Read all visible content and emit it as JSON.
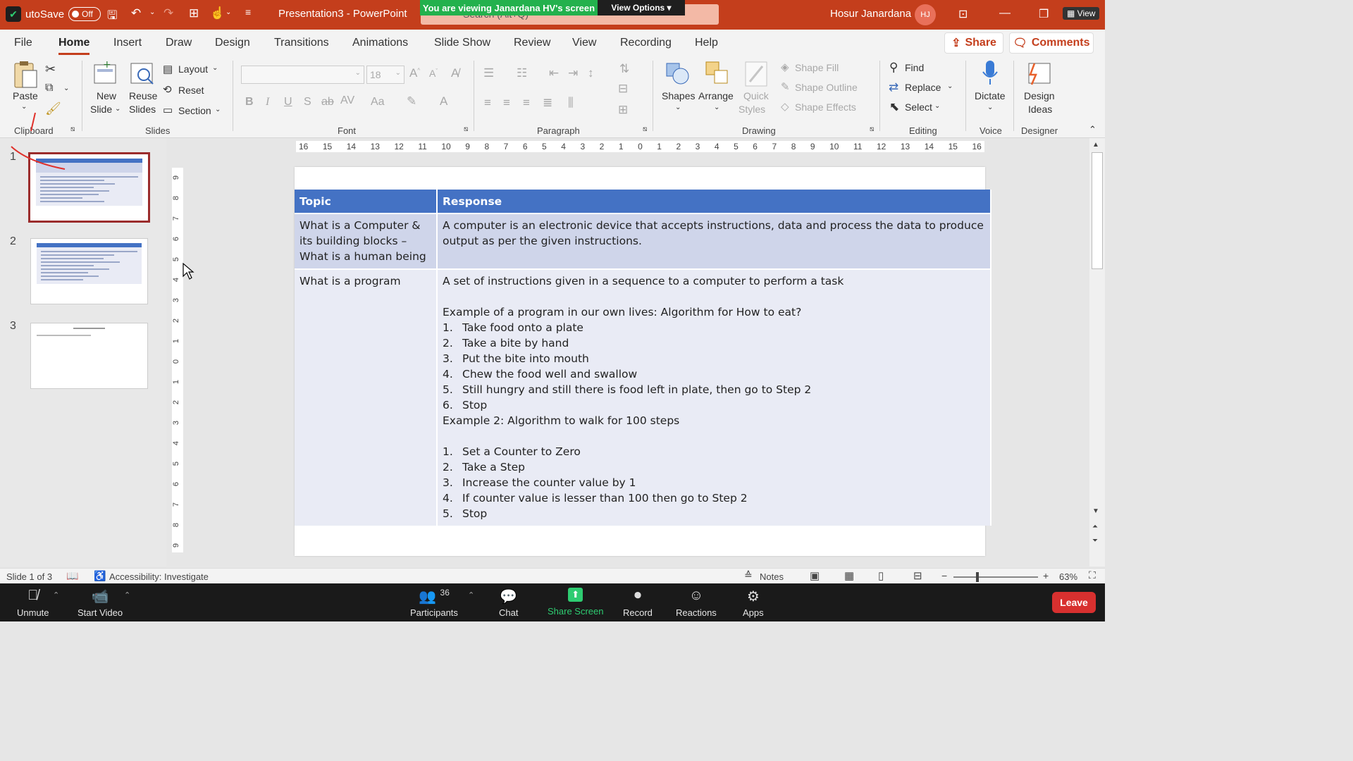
{
  "titlebar": {
    "autosave_label": "utoSave",
    "autosave_state": "Off",
    "title": "Presentation3  -  PowerPoint",
    "search_placeholder": "Search (Alt+Q)",
    "viewing_banner": "You are viewing Janardana HV's screen",
    "view_options": "View Options ▾",
    "user_name": "Hosur Janardana",
    "user_initials": "HJ",
    "view_btn": "View"
  },
  "menu": {
    "tabs": [
      "File",
      "Home",
      "Insert",
      "Draw",
      "Design",
      "Transitions",
      "Animations",
      "Slide Show",
      "Review",
      "View",
      "Recording",
      "Help"
    ],
    "share": "Share",
    "comments": "Comments"
  },
  "ribbon": {
    "clipboard": {
      "paste": "Paste",
      "label": "Clipboard"
    },
    "slides": {
      "new_slide_1": "New",
      "new_slide_2": "Slide",
      "reuse_1": "Reuse",
      "reuse_2": "Slides",
      "layout": "Layout",
      "reset": "Reset",
      "section": "Section",
      "label": "Slides"
    },
    "font": {
      "size": "18",
      "label": "Font"
    },
    "paragraph": {
      "label": "Paragraph"
    },
    "drawing": {
      "shapes": "Shapes",
      "arrange": "Arrange",
      "quick_styles_1": "Quick",
      "quick_styles_2": "Styles",
      "shape_fill": "Shape Fill",
      "shape_outline": "Shape Outline",
      "shape_effects": "Shape Effects",
      "label": "Drawing"
    },
    "editing": {
      "find": "Find",
      "replace": "Replace",
      "select": "Select",
      "label": "Editing"
    },
    "voice": {
      "dictate": "Dictate",
      "label": "Voice"
    },
    "designer": {
      "ideas_1": "Design",
      "ideas_2": "Ideas",
      "label": "Designer"
    }
  },
  "slides_pane": {
    "numbers": [
      "1",
      "2",
      "3"
    ]
  },
  "ruler": {
    "ticks": [
      "16",
      "15",
      "14",
      "13",
      "12",
      "11",
      "10",
      "9",
      "8",
      "7",
      "6",
      "5",
      "4",
      "3",
      "2",
      "1",
      "0",
      "1",
      "2",
      "3",
      "4",
      "5",
      "6",
      "7",
      "8",
      "9",
      "10",
      "11",
      "12",
      "13",
      "14",
      "15",
      "16"
    ],
    "vticks": [
      "9",
      "8",
      "7",
      "6",
      "5",
      "4",
      "3",
      "2",
      "1",
      "0",
      "1",
      "2",
      "3",
      "4",
      "5",
      "6",
      "7",
      "8",
      "9"
    ]
  },
  "table": {
    "headers": [
      "Topic",
      "Response"
    ],
    "row1": {
      "topic": "What is a Computer & its building blocks – What is a human being",
      "response": "A computer is an electronic device that accepts instructions, data and process the data to produce output as per the given instructions."
    },
    "row2": {
      "topic": "What is  a program",
      "intro": "A set of instructions given in a sequence to a computer to perform a task",
      "example1_title": "Example of a program in our own lives: Algorithm for How to eat?",
      "example1_steps": [
        {
          "n": "1.",
          "t": "Take food onto a plate"
        },
        {
          "n": "2.",
          "t": "Take a bite by hand"
        },
        {
          "n": "3.",
          "t": "Put the bite into mouth"
        },
        {
          "n": "4.",
          "t": "Chew the food well and swallow"
        },
        {
          "n": "5.",
          "t": "Still hungry and still there is food left in plate, then go to Step 2"
        },
        {
          "n": "6.",
          "t": "Stop"
        }
      ],
      "example2_title": "Example 2: Algorithm to walk for 100 steps",
      "example2_steps": [
        {
          "n": "1.",
          "t": "Set a Counter to Zero"
        },
        {
          "n": "2.",
          "t": "Take a Step"
        },
        {
          "n": "3.",
          "t": "Increase the counter value by 1"
        },
        {
          "n": "4.",
          "t": "If counter value is lesser than 100 then go to Step 2"
        },
        {
          "n": "5.",
          "t": "Stop"
        }
      ]
    }
  },
  "statusbar": {
    "slide_info": "Slide 1 of 3",
    "accessibility": "Accessibility: Investigate",
    "notes": "Notes",
    "zoom": "63%"
  },
  "zoombar": {
    "unmute": "Unmute",
    "start_video": "Start Video",
    "participants": "Participants",
    "participant_count": "36",
    "chat": "Chat",
    "share_screen": "Share Screen",
    "record": "Record",
    "reactions": "Reactions",
    "apps": "Apps",
    "leave": "Leave"
  },
  "colors": {
    "accent": "#c43e1c",
    "table_header": "#4472c4",
    "row_dark": "#cfd5ea",
    "row_light": "#e9ebf5",
    "share_green": "#2ecc71",
    "leave_red": "#d8302f"
  }
}
